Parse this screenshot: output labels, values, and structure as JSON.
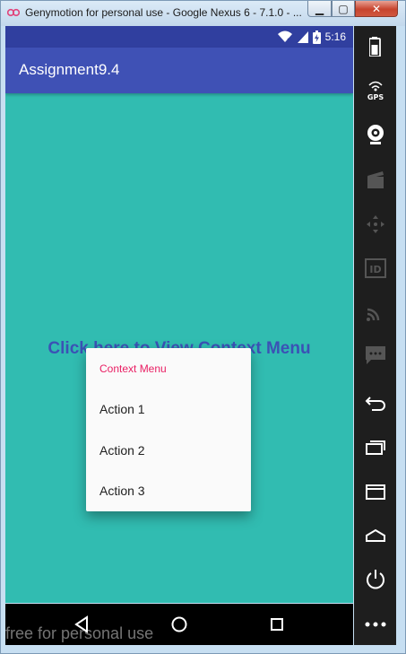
{
  "window": {
    "title": "Genymotion for personal use - Google Nexus 6 - 7.1.0 - ...",
    "min_glyph": "▁",
    "max_glyph": "▢",
    "close_glyph": "✕"
  },
  "status_bar": {
    "time": "5:16"
  },
  "app_bar": {
    "title": "Assignment9.4"
  },
  "main": {
    "link_text": "Click here to View Context Menu"
  },
  "context_menu": {
    "title": "Context Menu",
    "items": [
      {
        "label": "Action 1"
      },
      {
        "label": "Action 2"
      },
      {
        "label": "Action 3"
      }
    ]
  },
  "sidebar": {
    "gps_label": "GPS",
    "id_label": "ID"
  },
  "watermark": "free for personal use",
  "colors": {
    "status_bar": "#303f9f",
    "app_bar": "#3f51b5",
    "background": "#31bcb1",
    "accent": "#e91e63"
  }
}
